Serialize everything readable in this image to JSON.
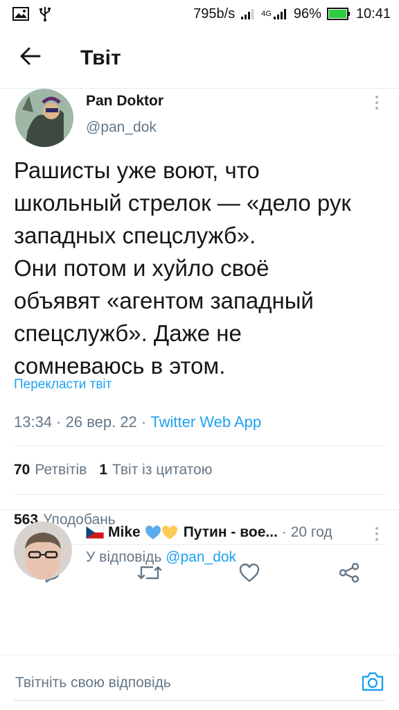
{
  "status_bar": {
    "speed": "795b/s",
    "network": "4G",
    "battery": "96%",
    "time": "10:41",
    "icons": [
      "image-icon",
      "usb-icon",
      "signal-icon",
      "battery-icon"
    ]
  },
  "header": {
    "title": "Твіт",
    "back_icon": "arrow-left-icon"
  },
  "tweet": {
    "author_name": "Pan Doktor",
    "author_handle": "@pan_dok",
    "text": "Рашисты уже воют, что\nшкольный стрелок — «дело рук\nзападных спецслужб».\nОни потом и хуйло своё\nобъявят «агентом западный\nспецслужб». Даже не\nсомневаюсь в этом.",
    "translate_label": "Перекласти твіт",
    "timestamp": "13:34 · 26 вер. 22 · ",
    "client": "Twitter Web App",
    "retweets_count": "70",
    "retweets_label": "Ретвітів",
    "quotes_count": "1",
    "quotes_label": "Твіт із цитатою",
    "likes_count": "563",
    "likes_label": "Уподобань",
    "actions": [
      "reply-icon",
      "retweet-icon",
      "like-icon",
      "share-icon"
    ]
  },
  "reply": {
    "flag": "czech-flag-icon",
    "name": "Mike",
    "hearts": [
      "blue-heart-icon",
      "yellow-heart-icon"
    ],
    "display_suffix": "Путин - вое...",
    "time": "· 20 год",
    "reply_to_label": "У відповідь ",
    "reply_to_handle": "@pan_dok"
  },
  "compose": {
    "placeholder": "Твітніть свою відповідь",
    "camera_icon": "camera-icon"
  },
  "colors": {
    "accent": "#1da1f2",
    "secondary_text": "#657786",
    "divider": "#e6ecf0"
  }
}
